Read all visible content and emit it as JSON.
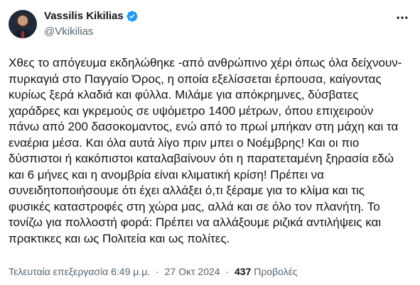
{
  "author": {
    "display_name": "Vassilis Kikilias",
    "handle": "@Vkikilias",
    "verified": true
  },
  "icons": {
    "verified": "verified-badge-icon",
    "more": "more-options-icon"
  },
  "colors": {
    "verified_blue": "#1d9bf0",
    "text": "#0f1419",
    "muted": "#536471"
  },
  "tweet": {
    "text": "Χθες το απόγευμα εκδηλώθηκε -από ανθρώπινο χέρι όπως όλα δείχνουν- πυρκαγιά στο Παγγαίο Όρος, η οποία εξελίσσεται έρπουσα, καίγοντας κυρίως ξερά κλαδιά και φύλλα. Μιλάμε για απόκρημνες, δύσβατες χαράδρες και γκρεμούς σε υψόμετρο 1400 μέτρων, όπου επιχειρούν πάνω από 200 δασοκομαντος, ενώ από το πρωί μπήκαν στη μάχη και τα εναέρια μέσα. Και όλα αυτά λίγο πριν μπει ο Νοέμβρης! Και οι πιο δύσπιστοι ή κακόπιστοι καταλαβαίνουν ότι η παρατεταμένη ξηρασία εδώ και 6 μήνες και η ανομβρία είναι κλιματική κρίση! Πρέπει να συνειδητοποιήσουμε ότι έχει αλλάξει ό,τι ξέραμε για το κλίμα και τις φυσικές καταστροφές στη χώρα μας, αλλά και σε όλο τον πλανήτη. Το τονίζω για πολλοστή φορά: Πρέπει να αλλάξουμε ριζικά αντιλήψεις και πρακτικες και ως Πολιτεία και ως πολίτες."
  },
  "meta": {
    "edited_label": "Τελευταία επεξεργασία",
    "time": "6:49 μ.μ.",
    "separator": "·",
    "date": "27 Οκτ 2024",
    "views_count": "437",
    "views_label": "Προβολές"
  }
}
